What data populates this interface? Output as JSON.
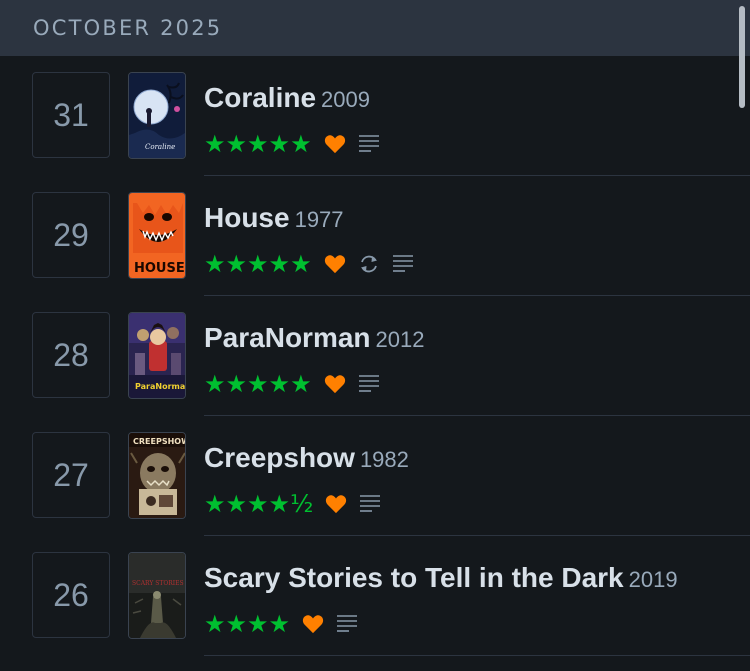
{
  "month_header": {
    "label": "OCTOBER 2025"
  },
  "colors": {
    "background": "#14181c",
    "header": "#2c3440",
    "star": "#00c030",
    "heart": "#ff8000",
    "muted": "#99aabb"
  },
  "entries": [
    {
      "day": "31",
      "title": "Coraline",
      "year": "2009",
      "rating": "★★★★★",
      "liked": true,
      "rewatch": false,
      "review": true,
      "poster_icon": "coraline-poster"
    },
    {
      "day": "29",
      "title": "House",
      "year": "1977",
      "rating": "★★★★★",
      "liked": true,
      "rewatch": true,
      "review": true,
      "poster_icon": "house-poster"
    },
    {
      "day": "28",
      "title": "ParaNorman",
      "year": "2012",
      "rating": "★★★★★",
      "liked": true,
      "rewatch": false,
      "review": true,
      "poster_icon": "paranorman-poster"
    },
    {
      "day": "27",
      "title": "Creepshow",
      "year": "1982",
      "rating": "★★★★½",
      "liked": true,
      "rewatch": false,
      "review": true,
      "poster_icon": "creepshow-poster"
    },
    {
      "day": "26",
      "title": "Scary Stories to Tell in the Dark",
      "year": "2019",
      "rating": "★★★★",
      "liked": true,
      "rewatch": false,
      "review": true,
      "poster_icon": "scary-stories-poster"
    }
  ]
}
